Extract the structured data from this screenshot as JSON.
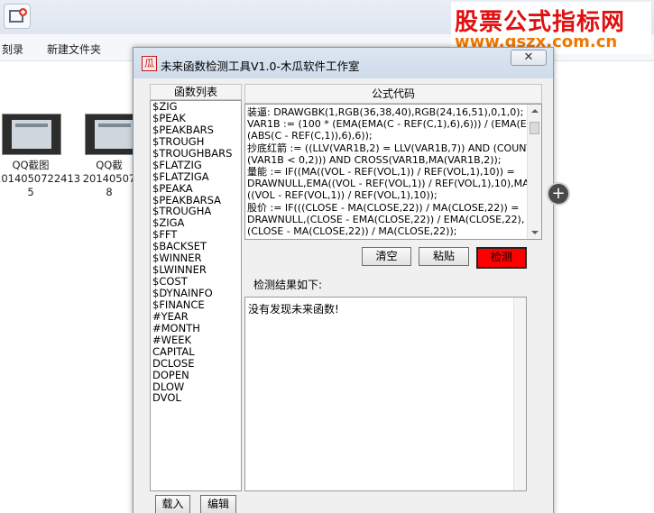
{
  "explorer": {
    "menu_item_1": "刻录",
    "menu_item_2": "新建文件夹",
    "files": [
      {
        "name_line1": "QQ截图",
        "name_line2": "2014050722413",
        "name_line3": "5"
      },
      {
        "name_line1": "QQ截",
        "name_line2": "20140507",
        "name_line3": "8"
      }
    ]
  },
  "watermark": {
    "title": "股票公式指标网",
    "url": "www.gszx.com.cn"
  },
  "dialog": {
    "app_icon_glyph": "瓜",
    "title": "未来函数检测工具V1.0-木瓜软件工作室",
    "function_list": {
      "header": "函数列表",
      "items": [
        "$ZIG",
        "$PEAK",
        "$PEAKBARS",
        "$TROUGH",
        "$TROUGHBARS",
        "$FLATZIG",
        "$FLATZIGA",
        "$PEAKA",
        "$PEAKBARSA",
        "$TROUGHA",
        "$ZIGA",
        "$FFT",
        "$BACKSET",
        "$WINNER",
        "$LWINNER",
        "$COST",
        "$DYNAINFO",
        "$FINANCE",
        "#YEAR",
        "#MONTH",
        "#WEEK",
        "CAPITAL",
        "DCLOSE",
        "DOPEN",
        "DLOW",
        "DVOL"
      ],
      "load_button": "载入",
      "edit_button": "编辑"
    },
    "formula": {
      "header": "公式代码",
      "code": "装逼: DRAWGBK(1,RGB(36,38,40),RGB(24,16,51),0,1,0);\nVAR1B := (100 * (EMA(EMA(C - REF(C,1),6),6))) / (EMA(EMA\n(ABS(C - REF(C,1)),6),6));\n抄底红箭 := ((LLV(VAR1B,2) = LLV(VAR1B,7)) AND (COUNT\n(VAR1B < 0,2))) AND CROSS(VAR1B,MA(VAR1B,2));\n量能 := IF((MA((VOL - REF(VOL,1)) / REF(VOL,1),10)) =\nDRAWNULL,EMA((VOL - REF(VOL,1)) / REF(VOL,1),10),MA\n((VOL - REF(VOL,1)) / REF(VOL,1),10));\n股价 := IF(((CLOSE - MA(CLOSE,22)) / MA(CLOSE,22)) =\nDRAWNULL,(CLOSE - EMA(CLOSE,22)) / EMA(CLOSE,22),\n(CLOSE - MA(CLOSE,22)) / MA(CLOSE,22));"
    },
    "buttons": {
      "clear": "清空",
      "paste": "粘贴",
      "detect": "检测"
    },
    "result": {
      "label": "检测结果如下:",
      "text": "没有发现未来函数!"
    }
  },
  "colors": {
    "detect_button_bg": "#ff0000",
    "watermark_title": "#e01010",
    "watermark_url": "#f07800"
  }
}
